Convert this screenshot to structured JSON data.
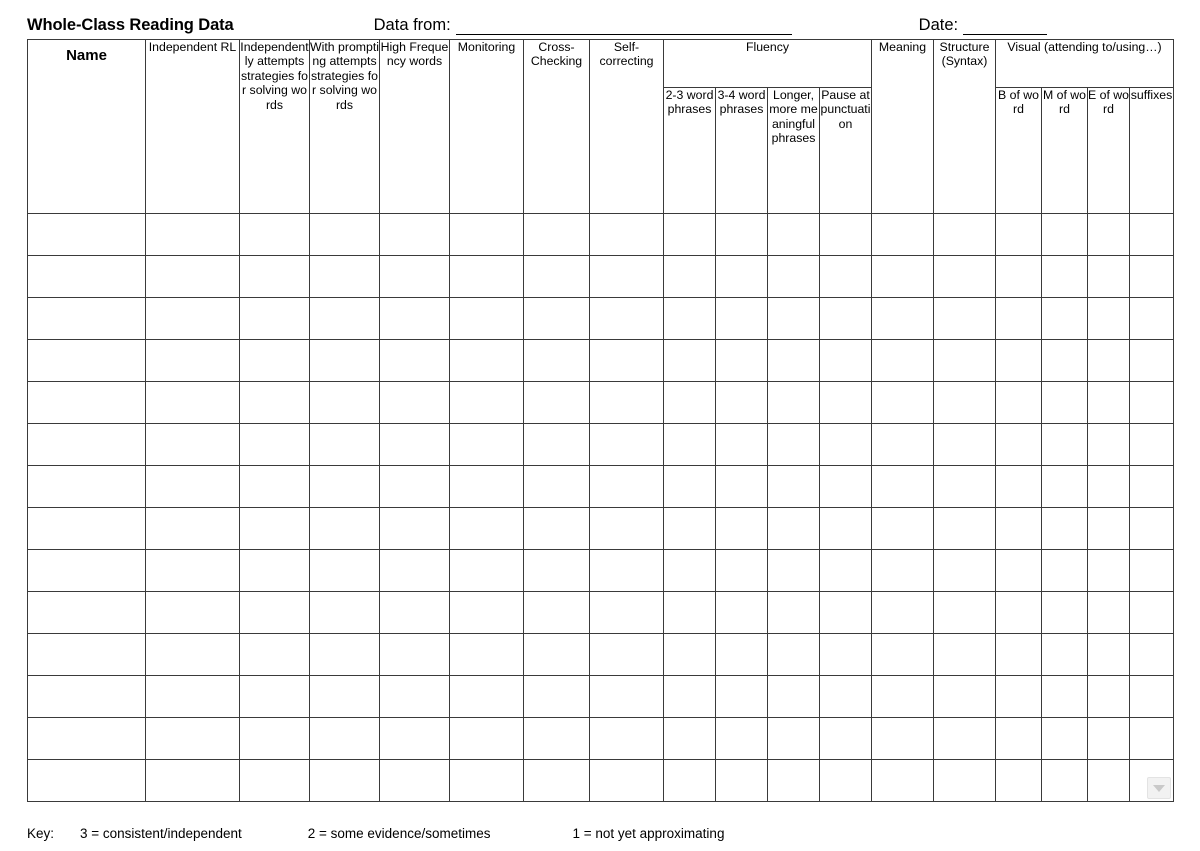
{
  "document": {
    "title": "Whole-Class Reading Data",
    "fields": [
      {
        "label": "Data from:",
        "value": "",
        "rule": "long"
      },
      {
        "label": "Date:",
        "value": "",
        "rule": "short"
      }
    ]
  },
  "table": {
    "row_count": 14,
    "columns": {
      "name": "Name",
      "independent_rl": "Independent RL",
      "independently_attempts": "Independently attempts strategies for solving words",
      "with_prompting_attempts": "With prompting attempts strategies for solving words",
      "high_frequency_words": "High Frequency words",
      "monitoring": "Monitoring",
      "cross_checking": "Cross-Checking",
      "self_correcting": "Self-correcting",
      "meaning": "Meaning",
      "structure_syntax": "Structure (Syntax)"
    },
    "groups": {
      "fluency": {
        "label": "Fluency",
        "subcolumns": [
          "2-3 word phrases",
          "3-4 word phrases",
          "Longer, more meaningful phrases",
          "Pause at punctuation"
        ]
      },
      "visual": {
        "label": "Visual (attending to/using…)",
        "subcolumns": [
          "B of word",
          "M of word",
          "E of word",
          "suffixes"
        ]
      }
    },
    "dropdown_widget": {
      "icon": "chevron-down-icon"
    }
  },
  "key": {
    "label": "Key:",
    "items": [
      "3 = consistent/independent",
      "2 = some evidence/sometimes",
      "1 = not yet approximating"
    ]
  }
}
